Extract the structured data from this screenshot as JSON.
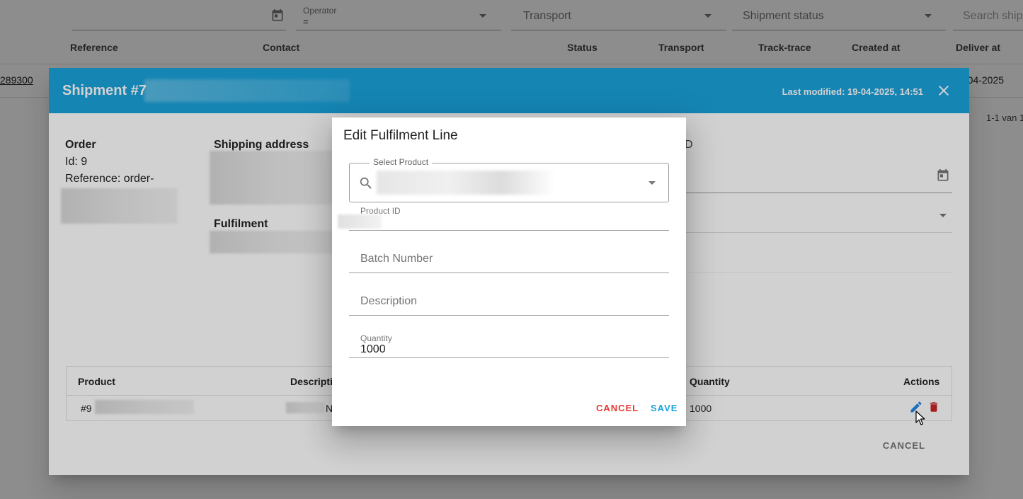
{
  "filters": {
    "operator_label": "Operator",
    "operator_value": "=",
    "transport_placeholder": "Transport",
    "shipment_status_placeholder": "Shipment status",
    "search_placeholder": "Search ship"
  },
  "table": {
    "headers": [
      "Reference",
      "Contact",
      "Status",
      "Transport",
      "Track-trace",
      "Created at",
      "Deliver at"
    ],
    "row": {
      "reference": "289300",
      "deliver_at": "-04-2025"
    },
    "pagination": "1-1 van 1"
  },
  "shipment_dialog": {
    "title": "Shipment #7",
    "last_modified": "Last modified: 19-04-2025, 14:51",
    "order_title": "Order",
    "order_id": "Id: 9",
    "order_reference": "Reference: order-",
    "shipping_address_title": "Shipping address",
    "fulfilment_title": "Fulfilment",
    "right_label_fragment": "D",
    "lines_table": {
      "headers": {
        "product": "Product",
        "description": "Descripti",
        "quantity": "Quantity",
        "actions": "Actions"
      },
      "row": {
        "product": "#9",
        "description_fragment": "N",
        "quantity": "1000"
      }
    },
    "cancel_label": "CANCEL",
    "fulfilment_fragment": "D"
  },
  "edit_dialog": {
    "title": "Edit Fulfilment Line",
    "select_product_label": "Select Product",
    "product_id_label": "Product ID",
    "batch_number_placeholder": "Batch Number",
    "description_placeholder": "Description",
    "quantity_label": "Quantity",
    "quantity_value": "1000",
    "cancel_label": "CANCEL",
    "save_label": "SAVE"
  },
  "colors": {
    "header_blue": "#1aa3dc",
    "cancel_red": "#e53935",
    "save_blue": "#1aa3dc",
    "edit_icon_blue": "#1e88e5",
    "delete_icon_red": "#c62828"
  }
}
